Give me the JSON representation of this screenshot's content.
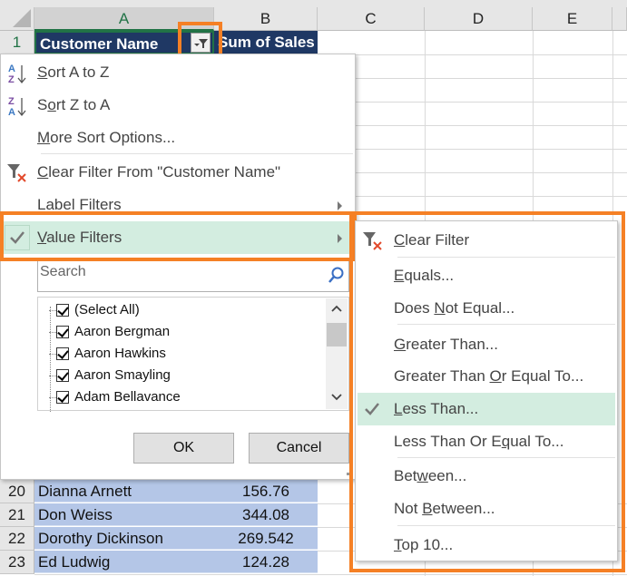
{
  "columns": [
    "A",
    "B",
    "C",
    "D",
    "E"
  ],
  "header_row": {
    "row": "1",
    "customer_name": "Customer Name",
    "sum_of_sales": "Sum of Sales"
  },
  "rows": [
    {
      "row": "20",
      "name": "Dianna Arnett",
      "sales": "156.76"
    },
    {
      "row": "21",
      "name": "Don Weiss",
      "sales": "344.08"
    },
    {
      "row": "22",
      "name": "Dorothy Dickinson",
      "sales": "269.542"
    },
    {
      "row": "23",
      "name": "Ed Ludwig",
      "sales": "124.28"
    }
  ],
  "filter_menu": {
    "sort_az": {
      "pre": "",
      "key": "S",
      "post": "ort A to Z",
      "icon": "sort-a-z-icon"
    },
    "sort_za": {
      "pre": "S",
      "key": "o",
      "post": "rt Z to A",
      "icon": "sort-z-a-icon"
    },
    "more_sort": {
      "pre": "",
      "key": "M",
      "post": "ore Sort Options...",
      "icon": ""
    },
    "clear_filter": {
      "pre": "",
      "key": "C",
      "post": "lear Filter From \"Customer Name\"",
      "icon": "clear-filter-icon"
    },
    "label_filters": {
      "pre": "Label Filters",
      "key": "",
      "post": ""
    },
    "value_filters": {
      "pre": "",
      "key": "V",
      "post": "alue Filters",
      "checked": true
    },
    "search_placeholder": "Search",
    "list_items": [
      {
        "label": "(Select All)",
        "checked": true
      },
      {
        "label": "Aaron Bergman",
        "checked": true
      },
      {
        "label": "Aaron Hawkins",
        "checked": true
      },
      {
        "label": "Aaron Smayling",
        "checked": true
      },
      {
        "label": "Adam Bellavance",
        "checked": true
      }
    ],
    "ok_label": "OK",
    "cancel_label": "Cancel"
  },
  "value_filters_menu": [
    {
      "pre": "",
      "key": "C",
      "post": "lear Filter"
    },
    {
      "pre": "",
      "key": "E",
      "post": "quals..."
    },
    {
      "pre": "Does ",
      "key": "N",
      "post": "ot Equal..."
    },
    {
      "pre": "",
      "key": "G",
      "post": "reater Than..."
    },
    {
      "pre": "Greater Than ",
      "key": "O",
      "post": "r Equal To..."
    },
    {
      "pre": "",
      "key": "L",
      "post": "ess Than...",
      "checked": true
    },
    {
      "pre": "Less Than Or E",
      "key": "q",
      "post": "ual To..."
    },
    {
      "pre": "Bet",
      "key": "w",
      "post": "een..."
    },
    {
      "pre": "Not ",
      "key": "B",
      "post": "etween..."
    },
    {
      "pre": "",
      "key": "T",
      "post": "op 10..."
    }
  ],
  "colors": {
    "accent_highlight": "#f58025",
    "header_fill": "#1f3864",
    "data_fill": "#b4c6e7",
    "menu_hover": "#d3ede0"
  }
}
